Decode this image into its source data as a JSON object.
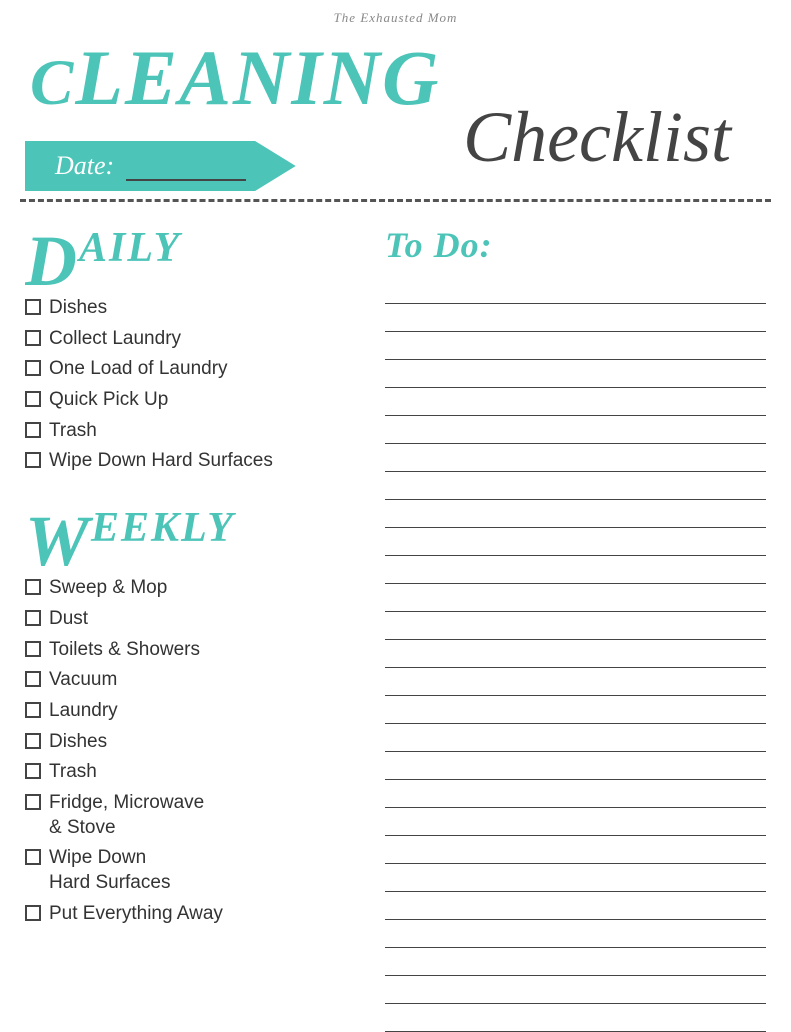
{
  "site_name": "The Exhausted Mom",
  "title_cleaning": "CLEANING",
  "title_checklist": "Checklist",
  "date_label": "Date:",
  "sections": {
    "daily": {
      "label": "Daily",
      "items": [
        "Dishes",
        "Collect Laundry",
        "One Load of Laundry",
        "Quick Pick Up",
        "Trash",
        "Wipe Down Hard Surfaces"
      ]
    },
    "weekly": {
      "label": "Weekly",
      "items": [
        "Sweep & Mop",
        "Dust",
        "Toilets & Showers",
        "Vacuum",
        "Laundry",
        "Dishes",
        "Trash",
        "Fridge, Microwave & Stove",
        "Wipe Down Hard Surfaces",
        "Put Everything Away"
      ]
    },
    "todo": {
      "label": "To Do:",
      "line_count": 27
    }
  }
}
